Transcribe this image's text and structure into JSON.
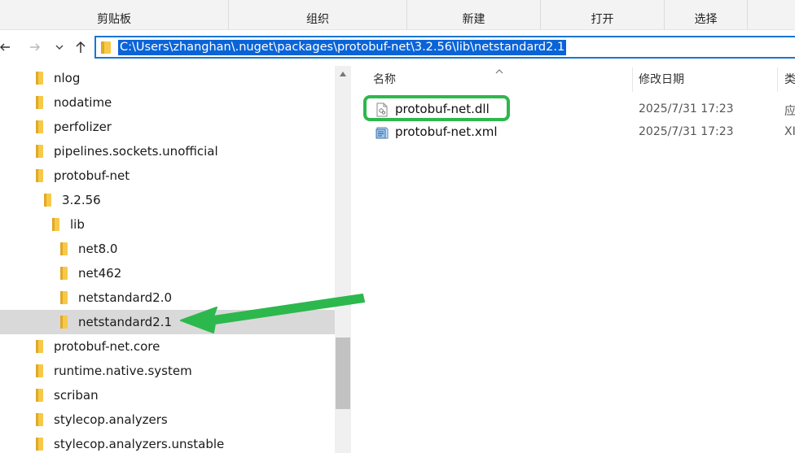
{
  "ribbon": {
    "groups": [
      {
        "label": "剪贴板"
      },
      {
        "label": "组织"
      },
      {
        "label": "新建"
      },
      {
        "label": "打开"
      },
      {
        "label": "选择"
      }
    ]
  },
  "navigation": {
    "back_icon": "back-arrow-icon",
    "forward_icon": "forward-arrow-icon",
    "recent_icon": "chevron-down-icon",
    "up_icon": "up-arrow-icon",
    "address": "C:\\Users\\zhanghan\\.nuget\\packages\\protobuf-net\\3.2.56\\lib\\netstandard2.1"
  },
  "tree": {
    "items": [
      {
        "label": "nlog"
      },
      {
        "label": "nodatime"
      },
      {
        "label": "perfolizer"
      },
      {
        "label": "pipelines.sockets.unofficial"
      },
      {
        "label": "protobuf-net"
      },
      {
        "label": "3.2.56"
      },
      {
        "label": "lib"
      },
      {
        "label": "net8.0"
      },
      {
        "label": "net462"
      },
      {
        "label": "netstandard2.0"
      },
      {
        "label": "netstandard2.1"
      },
      {
        "label": "protobuf-net.core"
      },
      {
        "label": "runtime.native.system"
      },
      {
        "label": "scriban"
      },
      {
        "label": "stylecop.analyzers"
      },
      {
        "label": "stylecop.analyzers.unstable"
      }
    ],
    "selected": "netstandard2.1"
  },
  "file_list": {
    "columns": {
      "name": "名称",
      "modified": "修改日期",
      "type": "类"
    },
    "files": [
      {
        "name": "protobuf-net.dll",
        "modified": "2025/7/31 17:23",
        "type": "应",
        "icon": "dll-file-icon"
      },
      {
        "name": "protobuf-net.xml",
        "modified": "2025/7/31 17:23",
        "type": "XI",
        "icon": "xml-file-icon"
      }
    ]
  },
  "colors": {
    "accent": "#0a64d8",
    "annotation": "#2db84d",
    "folder": "#f7c948",
    "selected_bg": "#d9d9d9"
  }
}
